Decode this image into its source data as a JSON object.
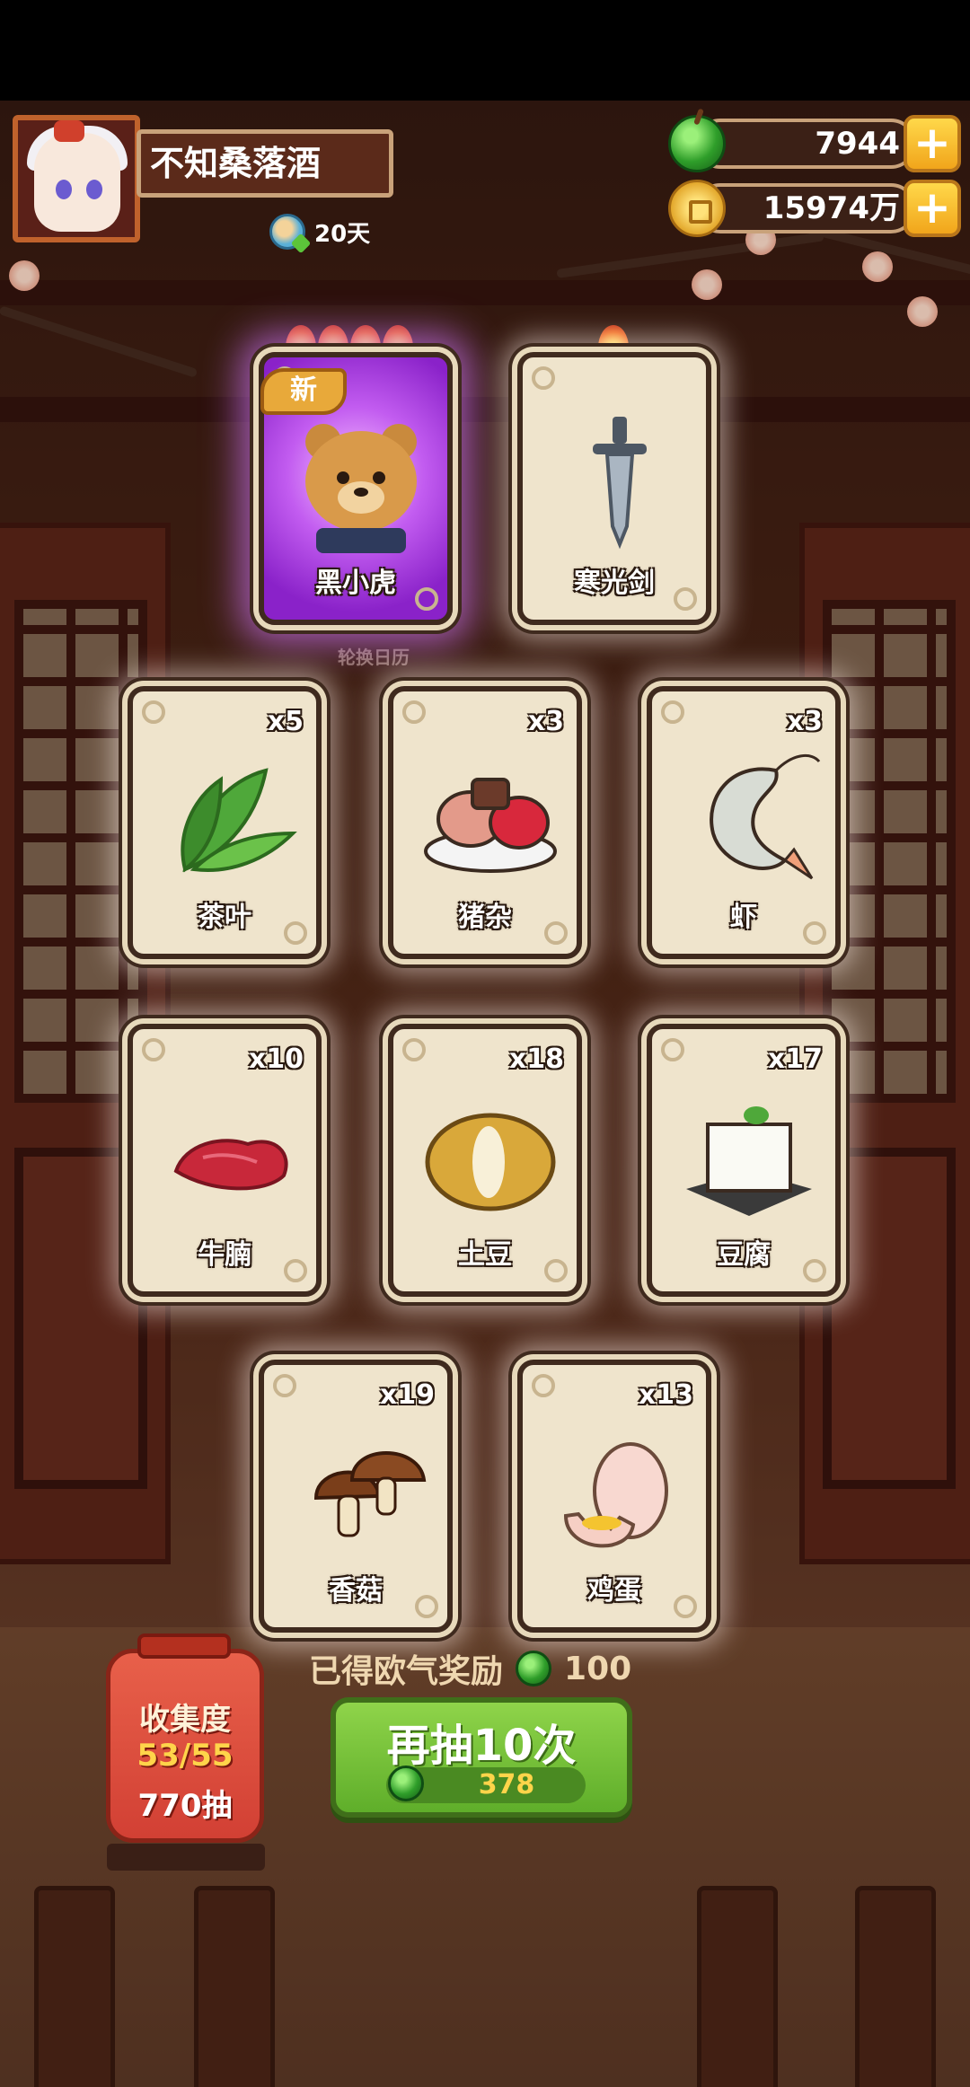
{
  "player": {
    "name": "不知桑落酒",
    "days": "20天"
  },
  "currencies": [
    {
      "type": "jade",
      "value": "7944"
    },
    {
      "type": "coin",
      "value": "15974万"
    }
  ],
  "cards": [
    {
      "name": "黑小虎",
      "count": "",
      "flames": 4,
      "is_new": true,
      "rarity": "special"
    },
    {
      "name": "寒光剑",
      "count": "",
      "flames": 1,
      "is_new": false,
      "rarity": "normal"
    },
    {
      "name": "茶叶",
      "count": "x5"
    },
    {
      "name": "猪杂",
      "count": "x3"
    },
    {
      "name": "虾",
      "count": "x3"
    },
    {
      "name": "牛腩",
      "count": "x10"
    },
    {
      "name": "土豆",
      "count": "x18"
    },
    {
      "name": "豆腐",
      "count": "x17"
    },
    {
      "name": "香菇",
      "count": "x19"
    },
    {
      "name": "鸡蛋",
      "count": "x13"
    }
  ],
  "new_badge": "新",
  "background_label": "轮换日历",
  "reward": {
    "text": "已得欧气奖励",
    "amount": "100"
  },
  "draw_button": {
    "label": "再抽10次",
    "cost": "378"
  },
  "collection": {
    "title": "收集度",
    "progress": "53/55",
    "draws": "770抽"
  },
  "colors": {
    "jade_green": "#2f9e2a",
    "button_green": "#6fbf33",
    "special_purple": "#a23cdc"
  }
}
